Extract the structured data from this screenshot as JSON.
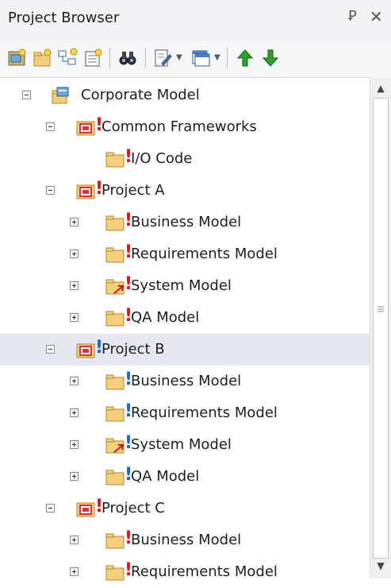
{
  "panel": {
    "title": "Project Browser",
    "pin_glyph": "Ꝑ",
    "close_glyph": "✕"
  },
  "toolbar": {
    "buttons": [
      {
        "name": "new-model-button",
        "icon": "new-model-icon"
      },
      {
        "name": "new-package-button",
        "icon": "new-package-icon"
      },
      {
        "name": "new-diagram-button",
        "icon": "new-diagram-icon"
      },
      {
        "name": "new-element-button",
        "icon": "new-element-icon"
      },
      {
        "name": "find-button",
        "icon": "binoculars-icon"
      },
      {
        "name": "document-button",
        "icon": "document-edit-icon"
      },
      {
        "name": "window-button",
        "icon": "window-icon"
      },
      {
        "name": "move-up-button",
        "icon": "arrow-up-icon"
      },
      {
        "name": "move-down-button",
        "icon": "arrow-down-icon"
      }
    ]
  },
  "tree": {
    "nodes": [
      {
        "label": "Corporate Model",
        "level": 0,
        "expander": "minus",
        "icon": "root-model-icon",
        "marker": ""
      },
      {
        "label": "Common Frameworks",
        "level": 1,
        "expander": "minus",
        "icon": "model-package-icon",
        "marker": "red"
      },
      {
        "label": "I/O Code",
        "level": 2,
        "expander": "none",
        "icon": "folder-icon",
        "marker": "red"
      },
      {
        "label": "Project A",
        "level": 1,
        "expander": "minus",
        "icon": "model-package-icon",
        "marker": "red"
      },
      {
        "label": "Business Model",
        "level": 2,
        "expander": "plus",
        "icon": "folder-icon",
        "marker": "red"
      },
      {
        "label": "Requirements Model",
        "level": 2,
        "expander": "plus",
        "icon": "folder-icon",
        "marker": "red"
      },
      {
        "label": "System Model",
        "level": 2,
        "expander": "plus",
        "icon": "folder-link-icon",
        "marker": "red"
      },
      {
        "label": "QA Model",
        "level": 2,
        "expander": "plus",
        "icon": "folder-icon",
        "marker": "red"
      },
      {
        "label": "Project B",
        "level": 1,
        "expander": "minus",
        "icon": "model-package-icon",
        "marker": "blue",
        "selected": true
      },
      {
        "label": "Business Model",
        "level": 2,
        "expander": "plus",
        "icon": "folder-icon",
        "marker": "blue"
      },
      {
        "label": "Requirements Model",
        "level": 2,
        "expander": "plus",
        "icon": "folder-icon",
        "marker": "blue"
      },
      {
        "label": "System Model",
        "level": 2,
        "expander": "plus",
        "icon": "folder-link-icon",
        "marker": "blue"
      },
      {
        "label": "QA Model",
        "level": 2,
        "expander": "plus",
        "icon": "folder-icon",
        "marker": "blue"
      },
      {
        "label": "Project C",
        "level": 1,
        "expander": "minus",
        "icon": "model-package-icon",
        "marker": "red"
      },
      {
        "label": "Business Model",
        "level": 2,
        "expander": "plus",
        "icon": "folder-icon",
        "marker": "red"
      },
      {
        "label": "Requirements Model",
        "level": 2,
        "expander": "plus",
        "icon": "folder-icon",
        "marker": "red"
      }
    ]
  },
  "colors": {
    "marker_red": "#e0131a",
    "marker_blue": "#1466d6",
    "folder": "#f2cf7a",
    "package_red": "#d9333b",
    "selection": "#e5e8ee"
  }
}
